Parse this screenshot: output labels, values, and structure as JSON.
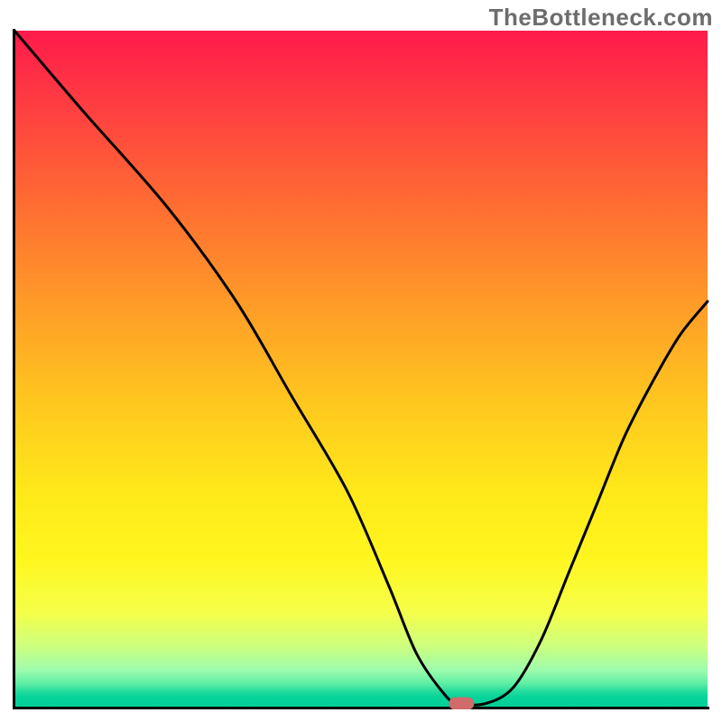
{
  "watermark": "TheBottleneck.com",
  "chart_data": {
    "type": "line",
    "title": "",
    "xlabel": "",
    "ylabel": "",
    "xlim": [
      0,
      100
    ],
    "ylim": [
      0,
      100
    ],
    "grid": false,
    "legend": false,
    "series": [
      {
        "name": "curve",
        "x": [
          0,
          10,
          22,
          32,
          40,
          48,
          54,
          58,
          62,
          64,
          68,
          72,
          76,
          80,
          84,
          88,
          92,
          96,
          100
        ],
        "y": [
          100,
          88,
          74,
          60,
          46,
          32,
          18,
          8,
          2,
          0.6,
          0.6,
          3,
          10,
          20,
          30,
          40,
          48,
          55,
          60
        ]
      }
    ],
    "marker": {
      "name": "optimal-point",
      "x": 64.5,
      "y": 0.6,
      "color": "#cf6b6b"
    },
    "background_gradient": {
      "stops": [
        {
          "offset": 0.0,
          "color": "#ff1a4b"
        },
        {
          "offset": 0.1,
          "color": "#ff3a42"
        },
        {
          "offset": 0.25,
          "color": "#ff6a33"
        },
        {
          "offset": 0.4,
          "color": "#ff9a28"
        },
        {
          "offset": 0.55,
          "color": "#ffc71f"
        },
        {
          "offset": 0.68,
          "color": "#ffe81a"
        },
        {
          "offset": 0.78,
          "color": "#fff61e"
        },
        {
          "offset": 0.86,
          "color": "#f5ff4a"
        },
        {
          "offset": 0.91,
          "color": "#ccff80"
        },
        {
          "offset": 0.945,
          "color": "#9dfcad"
        },
        {
          "offset": 0.965,
          "color": "#5ceea6"
        },
        {
          "offset": 0.975,
          "color": "#28dd9e"
        },
        {
          "offset": 0.985,
          "color": "#04d39a"
        },
        {
          "offset": 1.0,
          "color": "#03cf99"
        }
      ]
    },
    "axis_color": "#000000",
    "curve_stroke": "#000000",
    "curve_width": 3
  }
}
